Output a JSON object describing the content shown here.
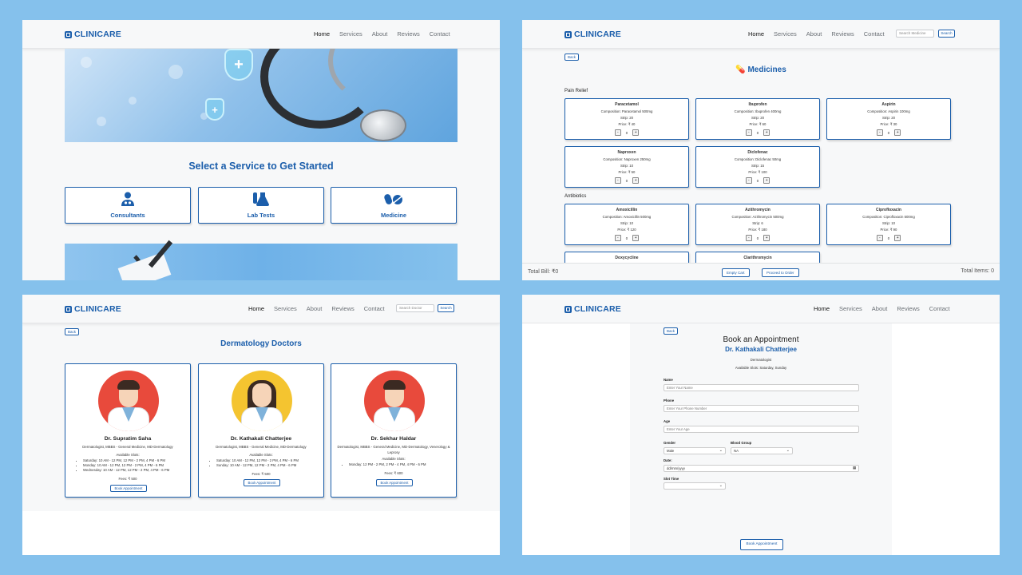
{
  "brand": "CLINICARE",
  "nav": {
    "home": "Home",
    "services": "Services",
    "about": "About",
    "reviews": "Reviews",
    "contact": "Contact"
  },
  "search": {
    "medicine_placeholder": "Search Medicine",
    "doctor_placeholder": "Search Doctor",
    "button": "Search"
  },
  "back_label": "Back",
  "home_page": {
    "title": "Select a Service to Get Started",
    "services": [
      {
        "label": "Consultants",
        "icon": "doctor-icon"
      },
      {
        "label": "Lab Tests",
        "icon": "flask-icon"
      },
      {
        "label": "Medicine",
        "icon": "pills-icon"
      }
    ]
  },
  "medicines_page": {
    "title": "Medicines",
    "categories": [
      {
        "name": "Pain Relief",
        "items": [
          {
            "name": "Paracetamol",
            "composition": "Composition: Paracetamol 500mg",
            "strip": "Strip: 20",
            "price": "Price: ₹ 40",
            "qty": "0"
          },
          {
            "name": "Ibuprofen",
            "composition": "Composition: Ibuprofen 400mg",
            "strip": "Strip: 20",
            "price": "Price: ₹ 60",
            "qty": "0"
          },
          {
            "name": "Aspirin",
            "composition": "Composition: Aspirin 100mg",
            "strip": "Strip: 20",
            "price": "Price: ₹ 30",
            "qty": "0"
          },
          {
            "name": "Naproxen",
            "composition": "Composition: Naproxen 250mg",
            "strip": "Strip: 10",
            "price": "Price: ₹ 50",
            "qty": "0"
          },
          {
            "name": "Diclofenac",
            "composition": "Composition: Diclofenac 50mg",
            "strip": "Strip: 15",
            "price": "Price: ₹ 100",
            "qty": "0"
          }
        ]
      },
      {
        "name": "Antibiotics",
        "items": [
          {
            "name": "Amoxicillin",
            "composition": "Composition: Amoxicillin 500mg",
            "strip": "Strip: 10",
            "price": "Price: ₹ 120",
            "qty": "0"
          },
          {
            "name": "Azithromycin",
            "composition": "Composition: Azithromycin 500mg",
            "strip": "Strip: 6",
            "price": "Price: ₹ 180",
            "qty": "0"
          },
          {
            "name": "Ciprofloxacin",
            "composition": "Composition: Ciprofloxacin 500mg",
            "strip": "Strip: 10",
            "price": "Price: ₹ 90",
            "qty": "0"
          },
          {
            "name": "Doxycycline"
          },
          {
            "name": "Clarithromycin"
          }
        ]
      }
    ],
    "total_bill": "Total Bill: ₹0",
    "empty_cart": "Empty Cart",
    "proceed": "Proceed to Order",
    "total_items": "Total Items: 0"
  },
  "derm_page": {
    "title": "Dermatology Doctors",
    "doctors": [
      {
        "name": "Dr. Supratim Saha",
        "specialty": "Dermatologist, MBBS - General Medicine, MD-Dermatology",
        "slots_title": "Available Slots:",
        "slots": [
          "Saturday: 10 AM - 12 PM, 12 PM - 2 PM, 4 PM - 6 PM",
          "Monday: 10 AM - 12 PM, 12 PM - 2 PM, 4 PM - 6 PM",
          "Wednesday: 10 AM - 12 PM, 12 PM - 2 PM, 4 PM - 6 PM"
        ],
        "fees": "Fees: ₹ 500",
        "button": "Book Appointment",
        "hair": "short",
        "bg": "#e84a3c"
      },
      {
        "name": "Dr. Kathakali Chatterjee",
        "specialty": "Dermatologist, MBBS - General Medicine, MD-Dermatology",
        "slots_title": "Available Slots:",
        "slots": [
          "Saturday: 10 AM - 12 PM, 12 PM - 2 PM, 4 PM - 6 PM",
          "Sunday: 10 AM - 12 PM, 12 PM - 2 PM, 4 PM - 6 PM"
        ],
        "fees": "Fees: ₹ 500",
        "button": "Book Appointment",
        "hair": "long",
        "bg": "#f4c430"
      },
      {
        "name": "Dr. Sekhar Haldar",
        "specialty": "Dermatologist, MBBS - General Medicine, MD-Dermatology, Venerology & Leprosy",
        "slots_title": "Available Slots:",
        "slots": [
          "Monday: 12 PM - 2 PM, 2 PM - 4 PM, 4 PM - 6 PM"
        ],
        "fees": "Fees: ₹ 600",
        "button": "Book Appointment",
        "hair": "short",
        "bg": "#e84a3c"
      }
    ]
  },
  "appointment_page": {
    "title": "Book an Appointment",
    "doctor": "Dr. Kathakali Chatterjee",
    "specialty": "Dermatologist",
    "available_slots": "Available Slots: Saturday, Sunday",
    "name_label": "Name",
    "name_placeholder": "Enter Your Name",
    "phone_label": "Phone",
    "phone_placeholder": "Enter Your Phone Number",
    "age_label": "Age",
    "age_placeholder": "Enter Your Age",
    "gender_label": "Gender",
    "gender_value": "Male",
    "blood_label": "Blood Group",
    "blood_value": "NA",
    "date_label": "Date:",
    "date_placeholder": "dd/mm/yyyy",
    "slot_label": "Slot Time",
    "button": "Book Appointment"
  },
  "colors": {
    "primary": "#1b5eab",
    "page_bg": "#85c1ec",
    "panel_bg": "#f7f8f9"
  }
}
